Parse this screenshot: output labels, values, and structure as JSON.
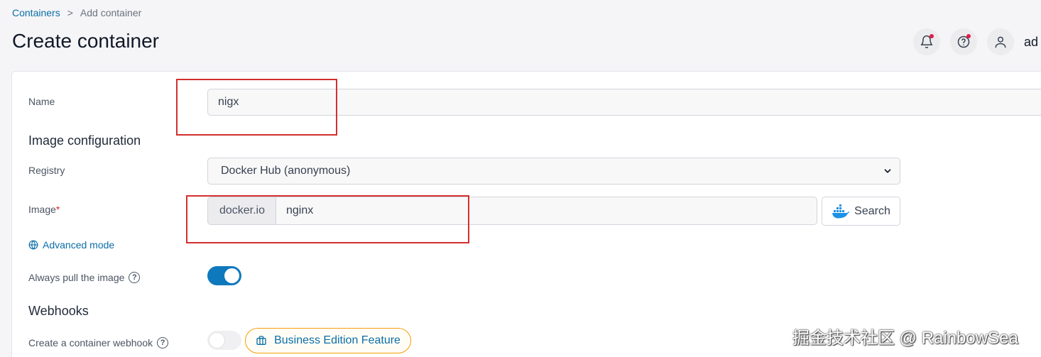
{
  "breadcrumb": {
    "parent": "Containers",
    "separator": ">",
    "current": "Add container"
  },
  "page": {
    "title": "Create container"
  },
  "header": {
    "user_name": "ad"
  },
  "form": {
    "name_label": "Name",
    "name_value": "nigx",
    "image_section_title": "Image configuration",
    "registry_label": "Registry",
    "registry_value": "Docker Hub (anonymous)",
    "image_label": "Image",
    "image_required": "*",
    "image_prefix": "docker.io",
    "image_value": "nginx",
    "search_label": "Search",
    "advanced_mode_label": "Advanced mode",
    "always_pull_label": "Always pull the image",
    "always_pull_enabled": true,
    "webhooks_title": "Webhooks",
    "webhook_label": "Create a container webhook",
    "webhook_enabled": false,
    "business_feature_label": "Business Edition Feature"
  },
  "watermark": "掘金技术社区 @ RainbowSea",
  "colors": {
    "accent": "#0e79bd",
    "link": "#0b6ea8",
    "highlight": "#d32f2f",
    "badge_border": "#f59e0b"
  }
}
